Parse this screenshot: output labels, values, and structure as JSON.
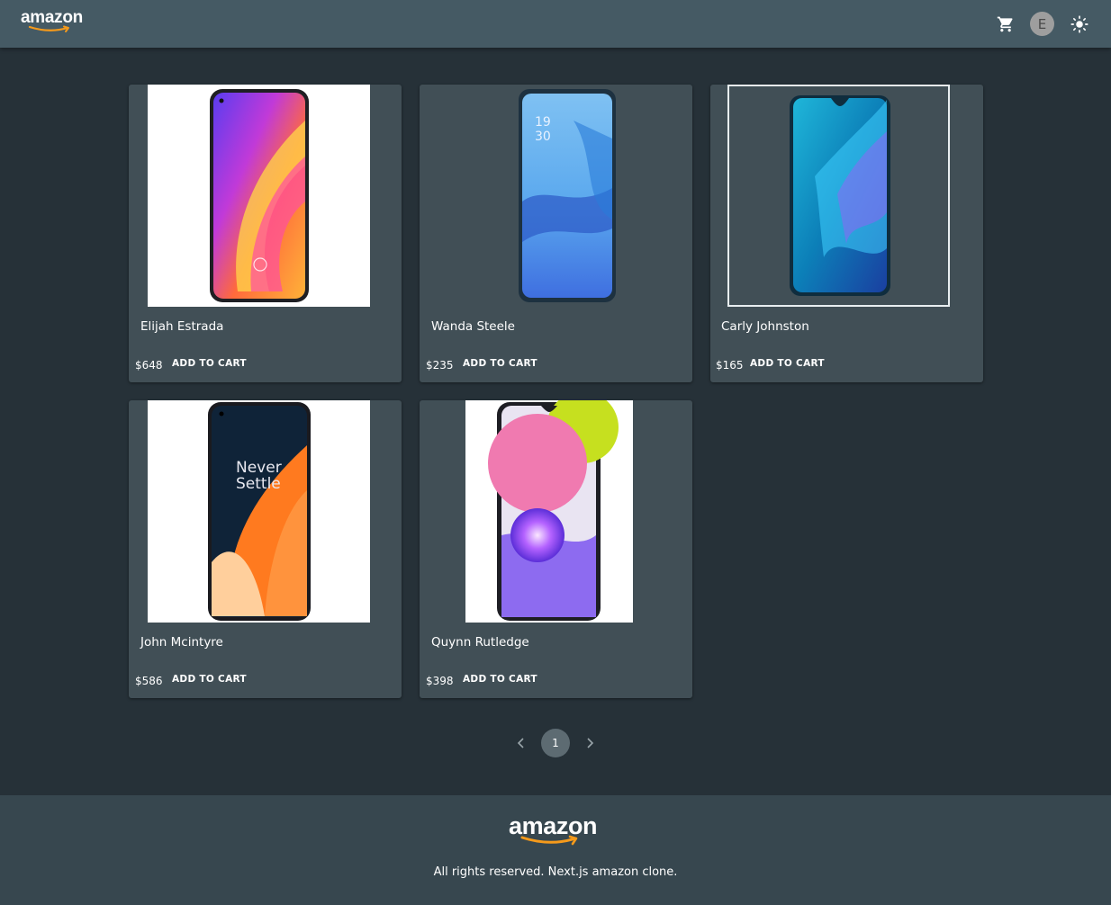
{
  "header": {
    "logo_text": "amazon",
    "avatar_letter": "E",
    "icons": {
      "cart": "shopping-cart-icon",
      "theme": "sun-icon"
    }
  },
  "products": [
    {
      "name": "Elijah Estrada",
      "price": "$648",
      "button": "ADD TO CART",
      "image": "phone-purple-orange"
    },
    {
      "name": "Wanda Steele",
      "price": "$235",
      "button": "ADD TO CART",
      "image": "phone-blue-splash"
    },
    {
      "name": "Carly Johnston",
      "price": "$165",
      "button": "ADD TO CART",
      "image": "phone-teal"
    },
    {
      "name": "John Mcintyre",
      "price": "$586",
      "button": "ADD TO CART",
      "image": "phone-never-settle",
      "screen_text": "Never Settle"
    },
    {
      "name": "Quynn Rutledge",
      "price": "$398",
      "button": "ADD TO CART",
      "image": "phone-pink-green"
    }
  ],
  "pagination": {
    "current_page": "1"
  },
  "footer": {
    "logo_text": "amazon",
    "text": "All rights reserved. Next.js amazon clone."
  },
  "colors": {
    "header_bg": "#455a64",
    "page_bg": "#263138",
    "card_bg": "#414f56",
    "footer_bg": "#37474f",
    "accent_smile": "#f59a1b"
  }
}
